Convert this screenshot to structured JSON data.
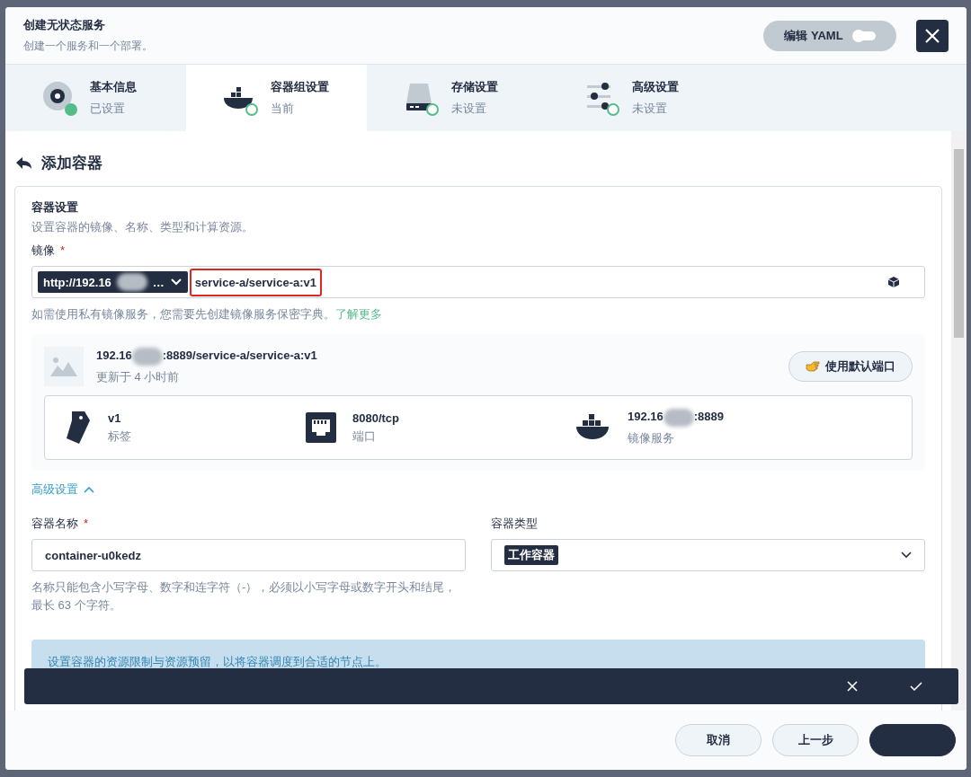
{
  "modal": {
    "title": "创建无状态服务",
    "subtitle": "创建一个服务和一个部署。",
    "yaml_toggle": {
      "label": "编辑 YAML",
      "on": false
    }
  },
  "steps": [
    {
      "kind": "info",
      "title": "基本信息",
      "status": "已设置",
      "done": true,
      "selected": false
    },
    {
      "kind": "docker",
      "title": "容器组设置",
      "status": "当前",
      "done": false,
      "selected": true
    },
    {
      "kind": "disk",
      "title": "存储设置",
      "status": "未设置",
      "done": false,
      "selected": false
    },
    {
      "kind": "sliders",
      "title": "高级设置",
      "status": "未设置",
      "done": false,
      "selected": false
    }
  ],
  "page_title": "添加容器",
  "section": {
    "title": "容器设置",
    "description": "设置容器的镜像、名称、类型和计算资源。"
  },
  "image": {
    "label": "镜像",
    "required_mark": "*",
    "registry_prefix": "http://192.16",
    "registry_suffix": "…",
    "value": "service-a/service-a:v1",
    "hint": "如需使用私有镜像服务，您需要先创建镜像服务保密字典。",
    "hint_link": "了解更多"
  },
  "image_card": {
    "name_prefix": "192.16",
    "name_suffix": ":8889/service-a/service-a:v1",
    "updated": "更新于 4 小时前",
    "button": "使用默认端口",
    "facts": [
      {
        "kind": "tag",
        "value": "v1",
        "label": "标签"
      },
      {
        "kind": "port",
        "value": "8080/tcp",
        "label": "端口"
      },
      {
        "kind": "docker",
        "value_prefix": "192.16",
        "value": ":8889",
        "label": "镜像服务"
      }
    ]
  },
  "advanced_toggle": {
    "label": "高级设置",
    "expanded": true
  },
  "container_name": {
    "label": "容器名称",
    "required_mark": "*",
    "value": "container-u0kedz",
    "hint": "名称只能包含小写字母、数字和连字符（-），必须以小写字母或数字开头和结尾，最长 63 个字符。"
  },
  "container_type": {
    "label": "容器类型",
    "value": "工作容器"
  },
  "resource_note": "设置容器的资源限制与资源预留，以将容器调度到合适的节点上。",
  "footer": {
    "buttons": [
      {
        "kind": "plain",
        "label": "取消"
      },
      {
        "kind": "plain",
        "label": "上一步"
      },
      {
        "kind": "primary"
      }
    ]
  }
}
